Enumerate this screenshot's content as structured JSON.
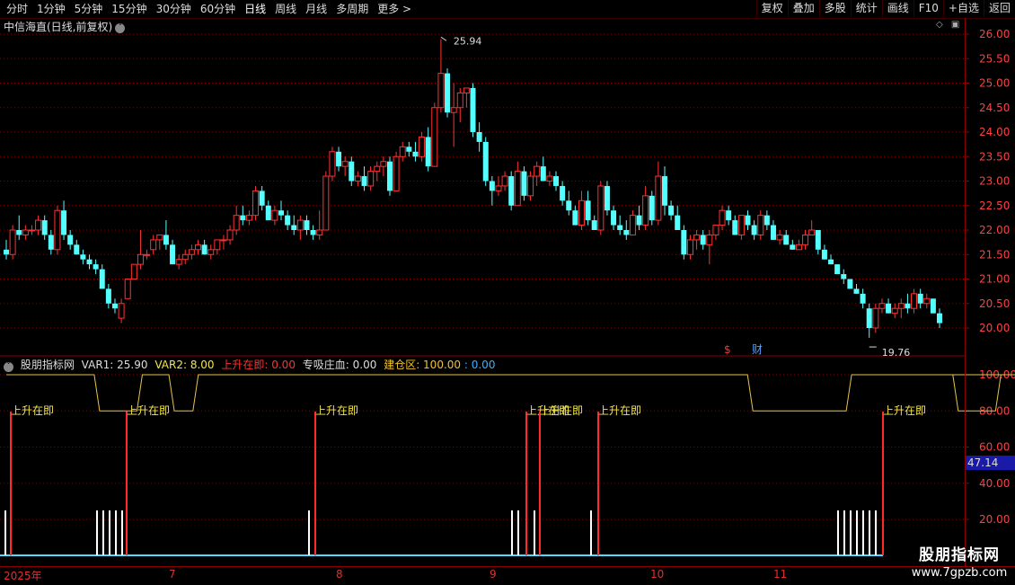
{
  "toolbar": {
    "periods": [
      "分时",
      "1分钟",
      "5分钟",
      "15分钟",
      "30分钟",
      "60分钟",
      "日线",
      "周线",
      "月线",
      "多周期",
      "更多 >"
    ],
    "active_period": "日线",
    "right_buttons": [
      "复权",
      "叠加",
      "多股",
      "统计",
      "画线",
      "F10",
      "+自选",
      "返回"
    ]
  },
  "main_chart": {
    "title": "中信海直(日线,前复权)",
    "high_label": "25.94",
    "low_label": "19.76",
    "price_ticks": [
      "26.00",
      "25.50",
      "25.00",
      "24.50",
      "24.00",
      "23.50",
      "23.00",
      "22.50",
      "22.00",
      "21.50",
      "21.00",
      "20.50",
      "20.00"
    ],
    "markers": [
      "$",
      "财"
    ],
    "colors": {
      "up": "#ff3232",
      "down": "#54ffff",
      "grid": "#8b0000"
    }
  },
  "indicator": {
    "name": "股朋指标网",
    "var1": "VAR1: 25.90",
    "var2": "VAR2: 8.00",
    "item1": "上升在即: 0.00",
    "item2": "专吸庄血: 0.00",
    "item3": "建仓区: 100.00",
    "item3_b": ": 0.00",
    "ticks": [
      "100.00",
      "80.00",
      "60.00",
      "40.00",
      "20.00"
    ],
    "current_value": "47.14",
    "signal_label": "上升在即"
  },
  "date_axis": [
    "2025年",
    "7",
    "8",
    "9",
    "10",
    "11"
  ],
  "watermark": {
    "line1": "股朋指标网",
    "line2": "www.7gpzb.com"
  },
  "chart_data": {
    "type": "candlestick",
    "title": "中信海直(日线,前复权)",
    "ylim": [
      19.6,
      26.2
    ],
    "candles": [
      [
        21.6,
        21.8,
        21.4,
        21.5
      ],
      [
        21.5,
        22.1,
        21.4,
        22.0
      ],
      [
        22.0,
        22.3,
        21.8,
        21.9
      ],
      [
        21.9,
        22.1,
        21.8,
        22.0
      ],
      [
        22.0,
        22.1,
        21.9,
        22.0
      ],
      [
        22.0,
        22.3,
        21.9,
        22.2
      ],
      [
        22.2,
        22.3,
        21.8,
        21.9
      ],
      [
        21.9,
        22.0,
        21.5,
        21.6
      ],
      [
        21.6,
        22.5,
        21.5,
        22.4
      ],
      [
        22.4,
        22.6,
        21.8,
        21.9
      ],
      [
        21.9,
        22.0,
        21.6,
        21.7
      ],
      [
        21.7,
        21.8,
        21.5,
        21.5
      ],
      [
        21.5,
        21.6,
        21.3,
        21.4
      ],
      [
        21.4,
        21.5,
        21.2,
        21.3
      ],
      [
        21.3,
        21.4,
        21.1,
        21.2
      ],
      [
        21.2,
        21.3,
        20.8,
        20.8
      ],
      [
        20.8,
        20.9,
        20.4,
        20.5
      ],
      [
        20.5,
        20.6,
        20.3,
        20.4
      ],
      [
        20.2,
        20.6,
        20.1,
        20.5
      ],
      [
        20.6,
        21.0,
        20.6,
        21.0
      ],
      [
        21.0,
        21.3,
        21.0,
        21.3
      ],
      [
        21.3,
        22.0,
        21.2,
        21.5
      ],
      [
        21.5,
        21.6,
        21.4,
        21.5
      ],
      [
        21.6,
        21.9,
        21.5,
        21.8
      ],
      [
        21.8,
        21.9,
        21.6,
        21.9
      ],
      [
        21.9,
        22.2,
        21.6,
        21.7
      ],
      [
        21.7,
        21.8,
        21.3,
        21.3
      ],
      [
        21.3,
        21.5,
        21.2,
        21.4
      ],
      [
        21.4,
        21.6,
        21.3,
        21.5
      ],
      [
        21.5,
        21.7,
        21.4,
        21.6
      ],
      [
        21.6,
        21.8,
        21.5,
        21.7
      ],
      [
        21.7,
        21.8,
        21.5,
        21.5
      ],
      [
        21.5,
        21.7,
        21.4,
        21.6
      ],
      [
        21.6,
        21.8,
        21.5,
        21.8
      ],
      [
        21.8,
        21.9,
        21.6,
        21.8
      ],
      [
        21.8,
        22.1,
        21.7,
        22.0
      ],
      [
        22.0,
        22.5,
        21.9,
        22.3
      ],
      [
        22.3,
        22.5,
        22.1,
        22.2
      ],
      [
        22.2,
        22.4,
        22.1,
        22.3
      ],
      [
        22.3,
        22.9,
        22.2,
        22.8
      ],
      [
        22.8,
        22.9,
        22.4,
        22.5
      ],
      [
        22.5,
        22.6,
        22.2,
        22.2
      ],
      [
        22.2,
        22.5,
        22.1,
        22.4
      ],
      [
        22.4,
        22.6,
        22.2,
        22.3
      ],
      [
        22.3,
        22.4,
        22.0,
        22.1
      ],
      [
        22.1,
        22.3,
        21.9,
        22.0
      ],
      [
        22.0,
        22.3,
        21.8,
        22.2
      ],
      [
        22.2,
        22.3,
        21.9,
        22.0
      ],
      [
        22.0,
        22.1,
        21.8,
        21.9
      ],
      [
        21.9,
        22.4,
        21.8,
        22.0
      ],
      [
        22.0,
        23.2,
        22.0,
        23.1
      ],
      [
        23.1,
        23.7,
        23.0,
        23.6
      ],
      [
        23.6,
        23.7,
        23.2,
        23.3
      ],
      [
        23.3,
        23.5,
        23.1,
        23.4
      ],
      [
        23.4,
        23.5,
        22.9,
        23.0
      ],
      [
        23.0,
        23.2,
        22.9,
        23.1
      ],
      [
        23.1,
        23.3,
        22.8,
        22.9
      ],
      [
        22.9,
        23.3,
        22.8,
        23.2
      ],
      [
        23.2,
        23.4,
        23.0,
        23.3
      ],
      [
        23.3,
        23.5,
        23.1,
        23.4
      ],
      [
        23.4,
        23.5,
        22.7,
        22.8
      ],
      [
        22.8,
        23.6,
        22.8,
        23.5
      ],
      [
        23.5,
        23.8,
        23.4,
        23.7
      ],
      [
        23.7,
        23.8,
        23.5,
        23.6
      ],
      [
        23.6,
        23.8,
        23.4,
        23.5
      ],
      [
        23.5,
        24.0,
        23.4,
        23.9
      ],
      [
        23.9,
        24.1,
        23.2,
        23.3
      ],
      [
        23.3,
        24.6,
        23.3,
        24.5
      ],
      [
        24.5,
        25.9,
        24.4,
        25.2
      ],
      [
        25.2,
        25.3,
        24.3,
        24.4
      ],
      [
        24.4,
        25.0,
        23.7,
        24.5
      ],
      [
        24.5,
        24.9,
        24.2,
        24.8
      ],
      [
        24.8,
        24.9,
        24.5,
        24.9
      ],
      [
        24.9,
        25.0,
        23.9,
        24.0
      ],
      [
        24.0,
        24.2,
        23.6,
        23.8
      ],
      [
        23.8,
        23.9,
        22.9,
        23.0
      ],
      [
        23.0,
        23.1,
        22.5,
        22.8
      ],
      [
        22.8,
        23.1,
        22.7,
        22.9
      ],
      [
        22.9,
        23.2,
        22.8,
        23.1
      ],
      [
        23.1,
        23.2,
        22.4,
        22.5
      ],
      [
        22.5,
        23.4,
        22.5,
        23.2
      ],
      [
        23.2,
        23.3,
        22.6,
        22.7
      ],
      [
        22.7,
        23.2,
        22.6,
        23.1
      ],
      [
        23.1,
        23.4,
        22.9,
        23.3
      ],
      [
        23.3,
        23.5,
        23.0,
        23.0
      ],
      [
        23.0,
        23.2,
        22.9,
        23.1
      ],
      [
        23.1,
        23.2,
        22.8,
        22.9
      ],
      [
        22.9,
        23.0,
        22.5,
        22.6
      ],
      [
        22.6,
        22.8,
        22.3,
        22.4
      ],
      [
        22.4,
        22.5,
        22.1,
        22.1
      ],
      [
        22.1,
        22.8,
        22.0,
        22.6
      ],
      [
        22.6,
        22.8,
        22.1,
        22.2
      ],
      [
        22.2,
        22.3,
        22.0,
        22.0
      ],
      [
        22.0,
        23.0,
        21.9,
        22.9
      ],
      [
        22.9,
        23.0,
        22.3,
        22.4
      ],
      [
        22.4,
        22.5,
        22.0,
        22.1
      ],
      [
        22.1,
        22.3,
        21.9,
        22.0
      ],
      [
        22.0,
        22.2,
        21.8,
        21.9
      ],
      [
        21.9,
        22.4,
        21.9,
        22.3
      ],
      [
        22.3,
        22.5,
        22.0,
        22.1
      ],
      [
        22.1,
        22.9,
        22.0,
        22.7
      ],
      [
        22.7,
        22.8,
        22.1,
        22.2
      ],
      [
        22.2,
        23.4,
        22.1,
        23.1
      ],
      [
        23.1,
        23.3,
        22.3,
        22.5
      ],
      [
        22.5,
        22.6,
        22.2,
        22.3
      ],
      [
        22.3,
        22.5,
        22.0,
        22.0
      ],
      [
        22.0,
        22.1,
        21.4,
        21.5
      ],
      [
        21.5,
        21.9,
        21.4,
        21.8
      ],
      [
        21.8,
        22.0,
        21.6,
        21.9
      ],
      [
        21.9,
        22.0,
        21.6,
        21.7
      ],
      [
        21.7,
        22.0,
        21.3,
        21.9
      ],
      [
        21.9,
        22.1,
        21.8,
        22.1
      ],
      [
        22.1,
        22.5,
        22.0,
        22.4
      ],
      [
        22.4,
        22.5,
        22.1,
        22.2
      ],
      [
        22.2,
        22.3,
        21.9,
        21.9
      ],
      [
        21.9,
        22.3,
        21.8,
        22.3
      ],
      [
        22.3,
        22.4,
        22.0,
        22.1
      ],
      [
        22.1,
        22.2,
        21.8,
        21.9
      ],
      [
        21.9,
        22.4,
        21.8,
        22.3
      ],
      [
        22.3,
        22.4,
        22.0,
        22.1
      ],
      [
        22.1,
        22.2,
        21.8,
        21.8
      ],
      [
        21.8,
        22.0,
        21.7,
        21.9
      ],
      [
        21.9,
        22.0,
        21.7,
        21.7
      ],
      [
        21.7,
        21.8,
        21.6,
        21.6
      ],
      [
        21.6,
        21.8,
        21.6,
        21.7
      ],
      [
        21.7,
        22.0,
        21.6,
        21.9
      ],
      [
        21.9,
        22.2,
        21.9,
        22.0
      ],
      [
        22.0,
        22.0,
        21.5,
        21.6
      ],
      [
        21.6,
        21.7,
        21.4,
        21.4
      ],
      [
        21.4,
        21.5,
        21.3,
        21.3
      ],
      [
        21.3,
        21.3,
        21.1,
        21.1
      ],
      [
        21.1,
        21.2,
        20.9,
        21.0
      ],
      [
        21.0,
        21.0,
        20.8,
        20.8
      ],
      [
        20.8,
        20.9,
        20.7,
        20.7
      ],
      [
        20.7,
        20.8,
        20.4,
        20.5
      ],
      [
        20.4,
        20.5,
        19.8,
        20.0
      ],
      [
        20.0,
        20.5,
        19.9,
        20.4
      ],
      [
        20.4,
        20.6,
        20.3,
        20.5
      ],
      [
        20.5,
        20.6,
        20.3,
        20.3
      ],
      [
        20.3,
        20.5,
        20.2,
        20.4
      ],
      [
        20.4,
        20.6,
        20.2,
        20.5
      ],
      [
        20.5,
        20.7,
        20.3,
        20.4
      ],
      [
        20.4,
        20.8,
        20.3,
        20.7
      ],
      [
        20.7,
        20.8,
        20.4,
        20.5
      ],
      [
        20.5,
        20.7,
        20.4,
        20.6
      ],
      [
        20.6,
        20.6,
        20.3,
        20.3
      ],
      [
        20.3,
        20.4,
        20.0,
        20.1
      ]
    ],
    "indicator_series": {
      "name": "建仓区",
      "values_pattern": "100 baseline with dips to 80",
      "dips": [
        [
          5,
          7
        ],
        [
          9,
          10
        ],
        [
          40,
          45
        ],
        [
          51,
          53
        ],
        [
          58,
          60
        ]
      ]
    }
  }
}
